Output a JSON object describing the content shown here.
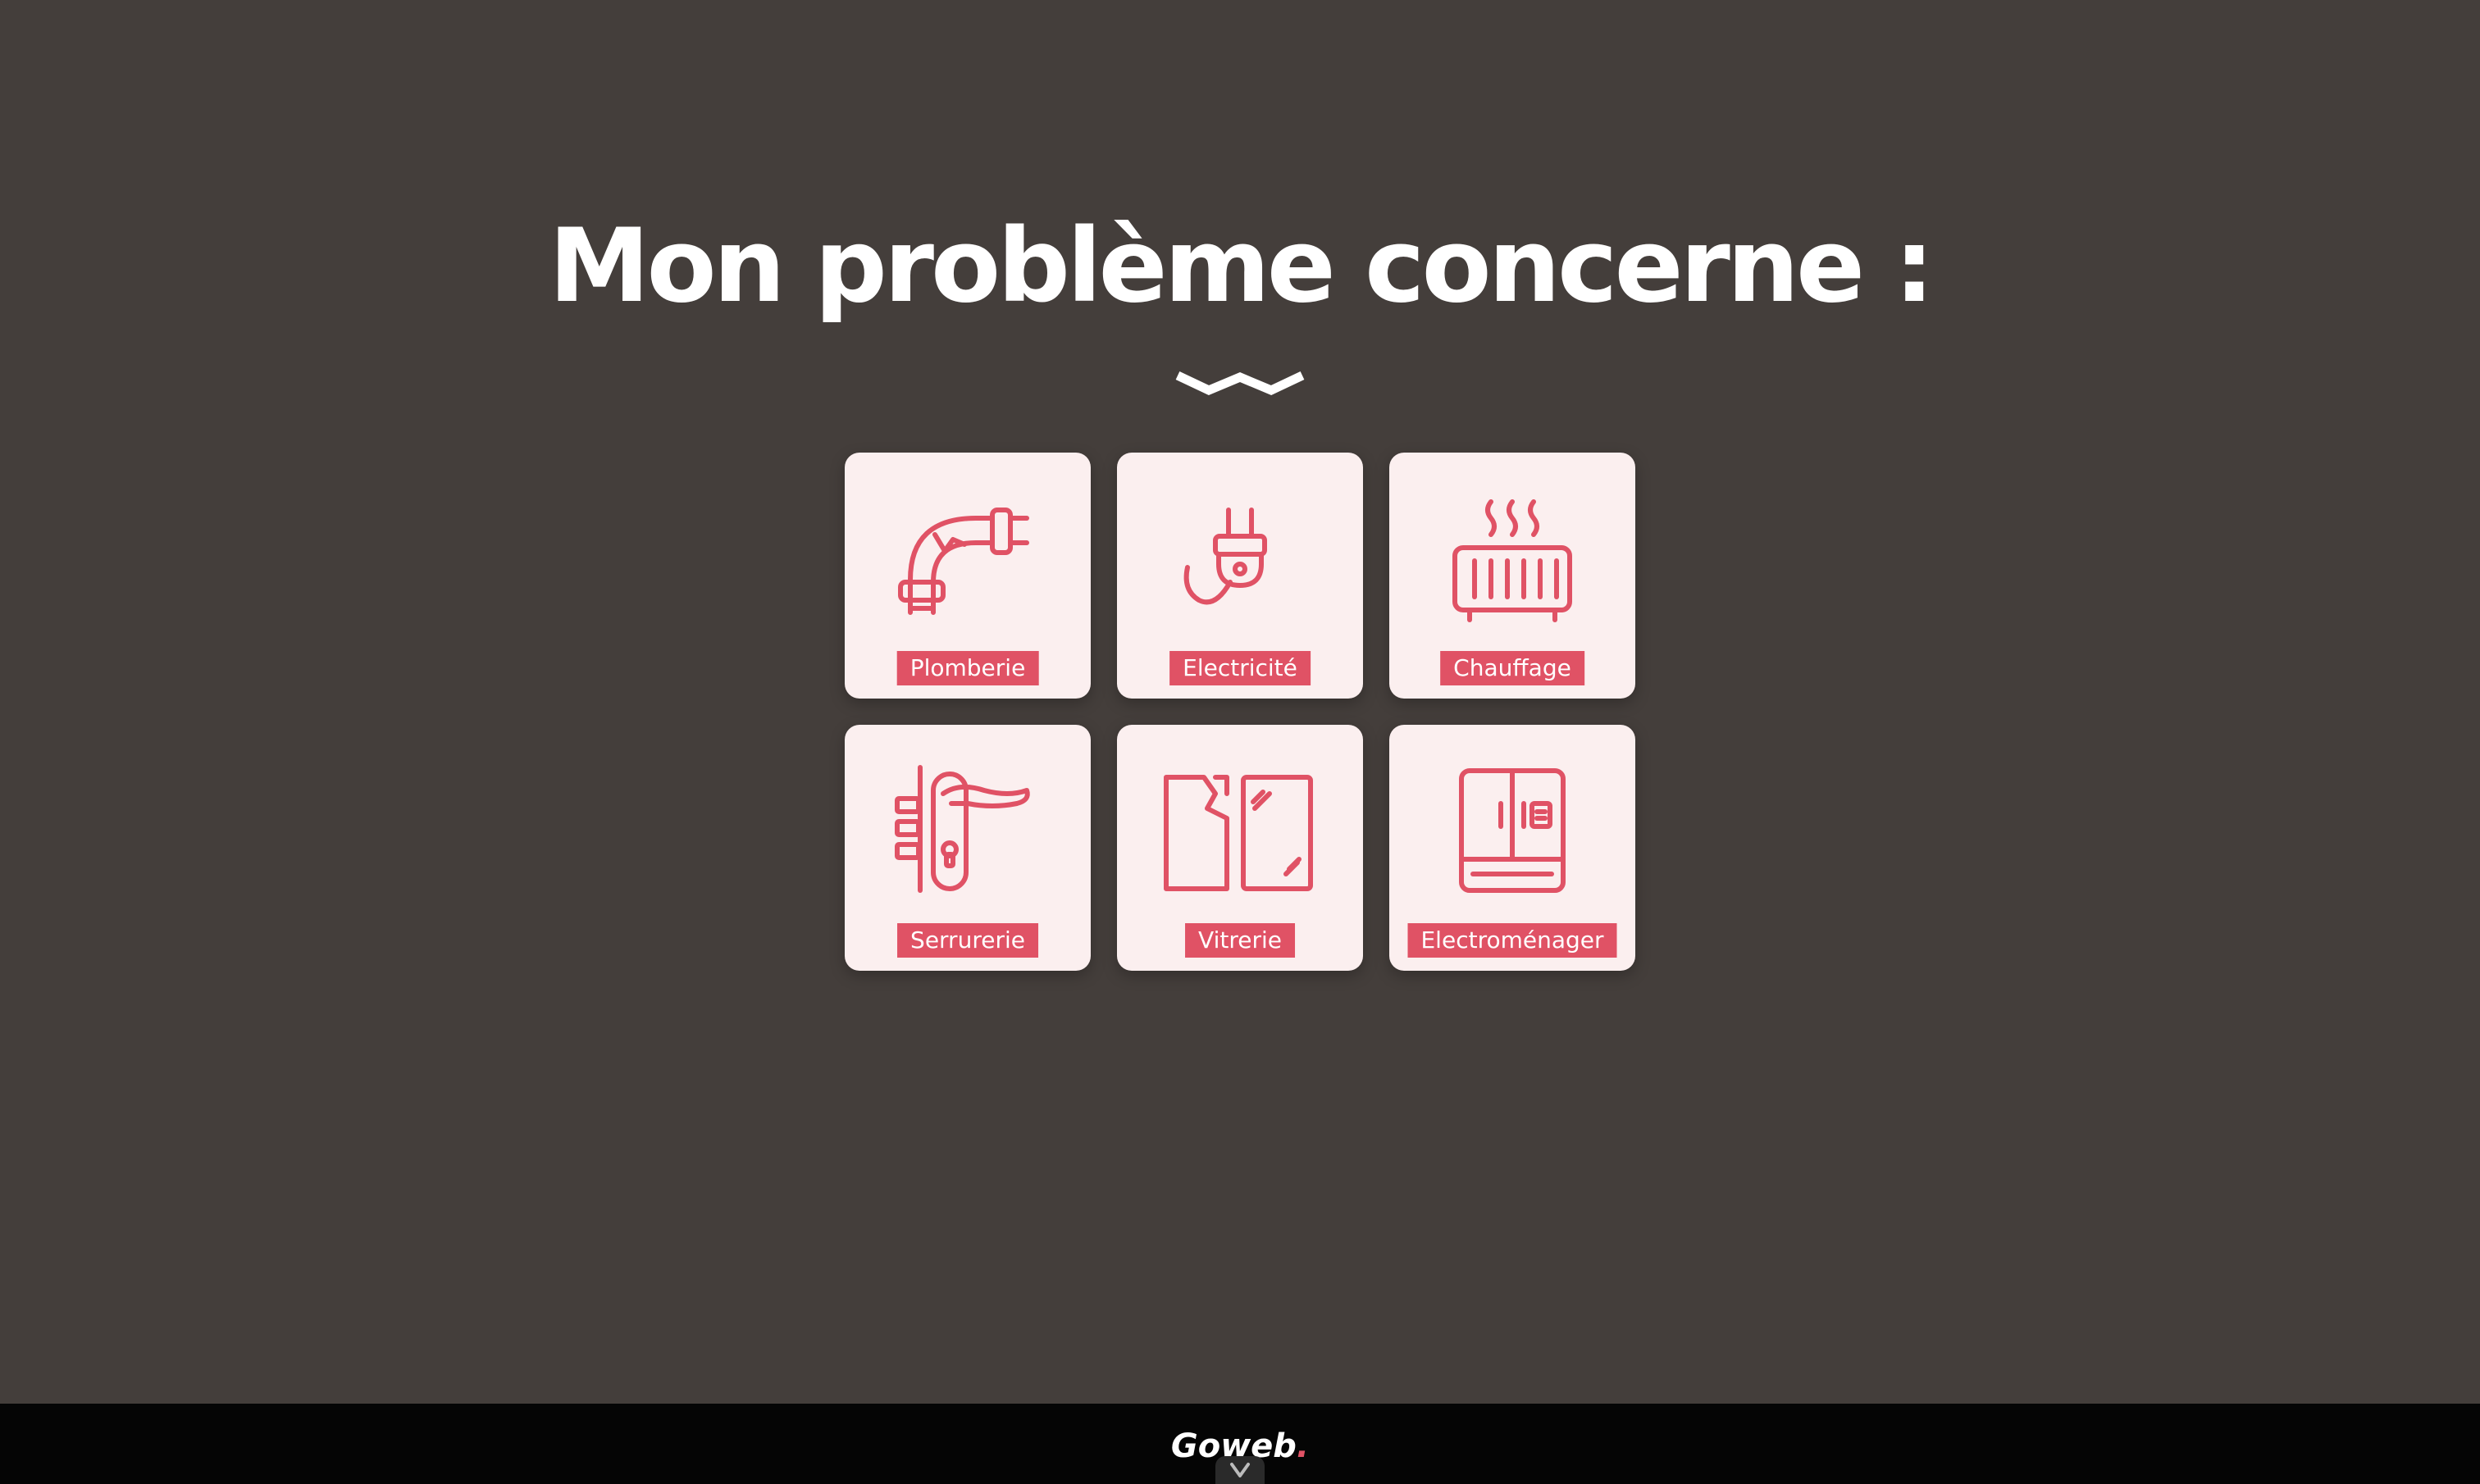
{
  "heading": "Mon problème concerne :",
  "accent_color": "#e05265",
  "card_background": "#fbefef",
  "page_background": "#443e3b",
  "categories": [
    {
      "label": "Plomberie",
      "icon": "pipe-icon"
    },
    {
      "label": "Electricité",
      "icon": "plug-icon"
    },
    {
      "label": "Chauffage",
      "icon": "radiator-icon"
    },
    {
      "label": "Serrurerie",
      "icon": "door-handle-icon"
    },
    {
      "label": "Vitrerie",
      "icon": "broken-window-icon"
    },
    {
      "label": "Electroménager",
      "icon": "fridge-icon"
    }
  ],
  "footer": {
    "logo_text": "Goweb",
    "logo_dot": "."
  }
}
